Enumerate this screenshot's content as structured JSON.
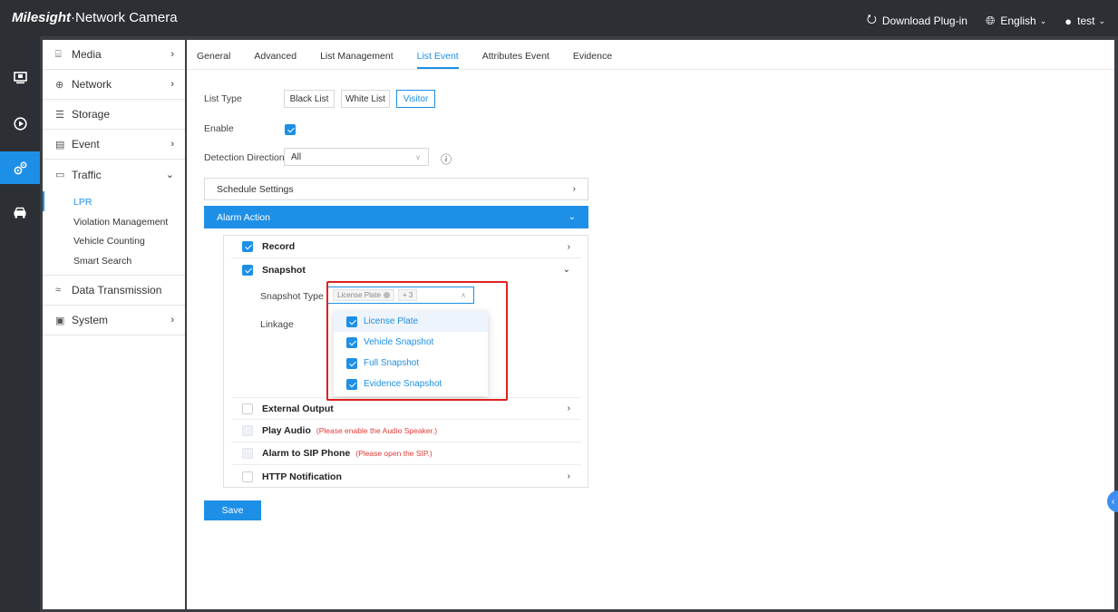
{
  "app": {
    "brand": "Milesight",
    "title": "·Network Camera",
    "download_plugin": "Download Plug-in",
    "language": "English",
    "user": "test"
  },
  "rail": {
    "items": [
      {
        "icon": "monitor-icon"
      },
      {
        "icon": "playback-icon"
      },
      {
        "icon": "settings-gears-icon",
        "active": true
      },
      {
        "icon": "car-icon"
      }
    ]
  },
  "menu": {
    "media": "Media",
    "network": "Network",
    "storage": "Storage",
    "event": "Event",
    "traffic": "Traffic",
    "traffic_sub": [
      "LPR",
      "Violation Management",
      "Vehicle Counting",
      "Smart Search"
    ],
    "data_transmission": "Data Transmission",
    "system": "System"
  },
  "tabs": [
    "General",
    "Advanced",
    "List Management",
    "List Event",
    "Attributes Event",
    "Evidence"
  ],
  "form": {
    "list_type_label": "List Type",
    "list_types": [
      "Black List",
      "White List",
      "Visitor"
    ],
    "selected_list_type": "Visitor",
    "enable_label": "Enable",
    "enable_checked": true,
    "detection_direction_label": "Detection Direction",
    "detection_direction_value": "All",
    "schedule_settings": "Schedule Settings",
    "alarm_action": "Alarm Action"
  },
  "actions": {
    "record": "Record",
    "snapshot": "Snapshot",
    "snapshot_type_label": "Snapshot Type",
    "snapshot_type_tag": "License Plate",
    "snapshot_type_more": "+ 3",
    "linkage_label": "Linkage",
    "external_output": "External Output",
    "play_audio": "Play Audio",
    "play_audio_warn": "(Please enable the Audio Speaker.)",
    "alarm_sip": "Alarm to SIP Phone",
    "alarm_sip_warn": "(Please open the SIP.)",
    "http_notification": "HTTP Notification"
  },
  "dropdown": {
    "options": [
      "License Plate",
      "Vehicle Snapshot",
      "Full Snapshot",
      "Evidence Snapshot"
    ]
  },
  "save_label": "Save",
  "colors": {
    "accent": "#1e8fe6",
    "topbar": "#2c2f34",
    "warning": "#e53935",
    "highlight": "#e02020"
  }
}
